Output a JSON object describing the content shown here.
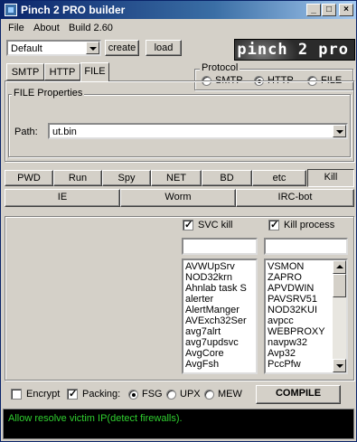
{
  "window": {
    "title": "Pinch 2 PRO builder"
  },
  "title_buttons": {
    "minimize": "_",
    "maximize": "□",
    "close": "×"
  },
  "menu": [
    "File",
    "About",
    "Build 2.60"
  ],
  "toolbar": {
    "profile_value": "Default",
    "create_label": "create",
    "load_label": "load",
    "banner_text": "pinch 2 pro"
  },
  "tabs": [
    {
      "label": "SMTP",
      "active": false
    },
    {
      "label": "HTTP",
      "active": false
    },
    {
      "label": "FILE",
      "active": true
    }
  ],
  "protocol": {
    "legend": "Protocol",
    "options": [
      {
        "label": "SMTP",
        "selected": false
      },
      {
        "label": "HTTP",
        "selected": true
      },
      {
        "label": "FILE",
        "selected": false
      }
    ]
  },
  "file_properties": {
    "legend": "FILE Properties",
    "path_label": "Path:",
    "path_value": "ut.bin"
  },
  "module_tabs_row1": [
    {
      "label": "PWD",
      "active": false
    },
    {
      "label": "Run",
      "active": false
    },
    {
      "label": "Spy",
      "active": false
    },
    {
      "label": "NET",
      "active": false
    },
    {
      "label": "BD",
      "active": false
    },
    {
      "label": "etc",
      "active": false
    },
    {
      "label": "Kill",
      "active": true
    }
  ],
  "module_tabs_row2": [
    {
      "label": "IE"
    },
    {
      "label": "Worm"
    },
    {
      "label": "IRC-bot"
    }
  ],
  "kill": {
    "svc_kill_label": "SVC kill",
    "svc_kill_checked": true,
    "kill_process_label": "Kill process",
    "kill_process_checked": true,
    "svc_filter_value": "",
    "process_filter_value": "",
    "services": [
      "AVWUpSrv",
      "NOD32krn",
      "Ahnlab task S",
      "alerter",
      "AlertManger",
      "AVExch32Ser",
      "avg7alrt",
      "avg7updsvc",
      "AvgCore",
      "AvgFsh"
    ],
    "processes": [
      "VSMON",
      "ZAPRO",
      "APVDWIN",
      "PAVSRV51",
      "NOD32KUI",
      "avpcc",
      "WEBPROXY",
      "navpw32",
      "Avp32",
      "PccPfw"
    ]
  },
  "bottom": {
    "encrypt_label": "Encrypt",
    "encrypt_checked": false,
    "packing_label": "Packing:",
    "packing_checked": true,
    "packers": [
      {
        "label": "FSG",
        "selected": true
      },
      {
        "label": "UPX",
        "selected": false
      },
      {
        "label": "MEW",
        "selected": false
      }
    ],
    "compile_label": "COMPILE"
  },
  "status_text": "Allow resolve victim IP(detect firewalls)."
}
